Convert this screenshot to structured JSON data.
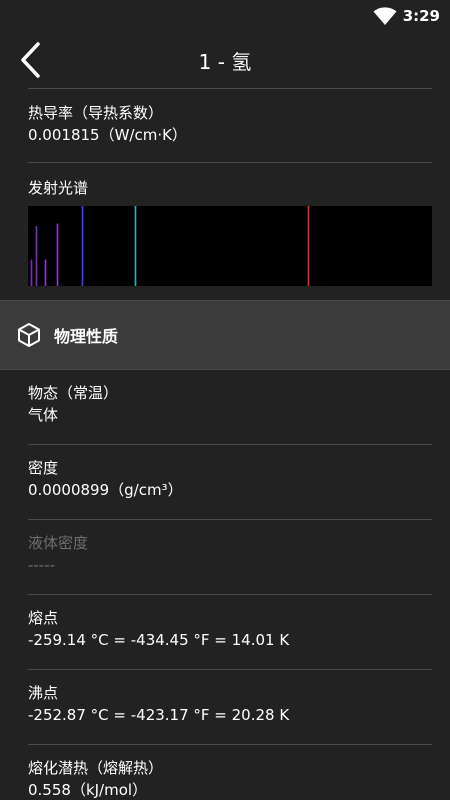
{
  "status_bar": {
    "time": "3:29",
    "icon": "wifi-icon"
  },
  "app_bar": {
    "title": "1 - 氢",
    "back_icon": "back-chevron-icon"
  },
  "thermal_conductivity": {
    "label": "热导率（导热系数）",
    "value": "0.001815（W/cm·K）"
  },
  "emission_spectrum": {
    "label": "发射光谱",
    "lines": [
      {
        "position": 0.007,
        "height": 0.33,
        "color": "#7a2fbf"
      },
      {
        "position": 0.02,
        "height": 0.75,
        "color": "#7d32c4"
      },
      {
        "position": 0.042,
        "height": 0.33,
        "color": "#8d3ad6"
      },
      {
        "position": 0.073,
        "height": 0.78,
        "color": "#8a3fd0"
      },
      {
        "position": 0.134,
        "height": 1.0,
        "color": "#4a3cff"
      },
      {
        "position": 0.265,
        "height": 1.0,
        "color": "#22b6c4"
      },
      {
        "position": 0.692,
        "height": 1.0,
        "color": "#e0301e"
      }
    ]
  },
  "physical_properties": {
    "title": "物理性质",
    "icon": "cube-icon"
  },
  "state": {
    "label": "物态（常温）",
    "value": "气体"
  },
  "density": {
    "label": "密度",
    "value": "0.0000899（g/cm³）"
  },
  "liquid_density": {
    "label": "液体密度",
    "value": "-----"
  },
  "melting_point": {
    "label": "熔点",
    "value": "-259.14 °C = -434.45 °F = 14.01 K"
  },
  "boiling_point": {
    "label": "沸点",
    "value": "-252.87 °C = -423.17 °F = 20.28 K"
  },
  "heat_of_fusion": {
    "label": "熔化潜热（熔解热）",
    "value": "0.558（kJ/mol）"
  }
}
